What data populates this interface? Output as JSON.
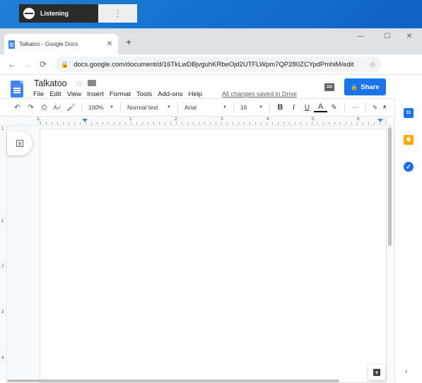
{
  "overlay": {
    "label": "Listening",
    "menu_glyph": "⋮"
  },
  "browser": {
    "tab_title": "Talkatoo - Google Docs",
    "tab_close": "✕",
    "new_tab": "+",
    "controls": {
      "minimize": "—",
      "maximize": "☐",
      "close": "✕"
    },
    "nav": {
      "back": "←",
      "forward": "→",
      "reload": "⟳"
    },
    "url": "docs.google.com/document/d/16TkLwDBjvguhKRbeOjd2UTFLWpm7QP280ZCYpdPmhiM/edit",
    "lock": "🔒",
    "bookmark": "☆"
  },
  "docs": {
    "title": "Talkatoo",
    "star": "☆",
    "menu": [
      "File",
      "Edit",
      "View",
      "Insert",
      "Format",
      "Tools",
      "Add-ons",
      "Help"
    ],
    "saved_status": "All changes saved in Drive",
    "share_label": "Share",
    "share_lock": "🔒"
  },
  "toolbar": {
    "undo": "↶",
    "redo": "↷",
    "print": "⎙",
    "spellcheck": "A✓",
    "paint_format": "🖌",
    "zoom": "100%",
    "style": "Normal text",
    "font": "Arial",
    "font_size": "16",
    "bold": "B",
    "italic": "I",
    "underline": "U",
    "text_color": "A",
    "highlight": "✎",
    "more": "⋯",
    "editing_mode": "✎",
    "collapse": "∧"
  },
  "ruler": {
    "numbers": [
      "1",
      "1",
      "2",
      "3",
      "4",
      "5",
      "6"
    ]
  },
  "vruler": {
    "numbers": [
      "1",
      "1",
      "2",
      "3",
      "4"
    ]
  },
  "side_panel": {
    "calendar_label": "31",
    "tasks_label": "✓",
    "expand": "›"
  },
  "explore": {
    "label": "+"
  },
  "colors": {
    "accent": "#1a73e8",
    "docs_blue": "#4285f4",
    "keep_yellow": "#f9ab00"
  }
}
